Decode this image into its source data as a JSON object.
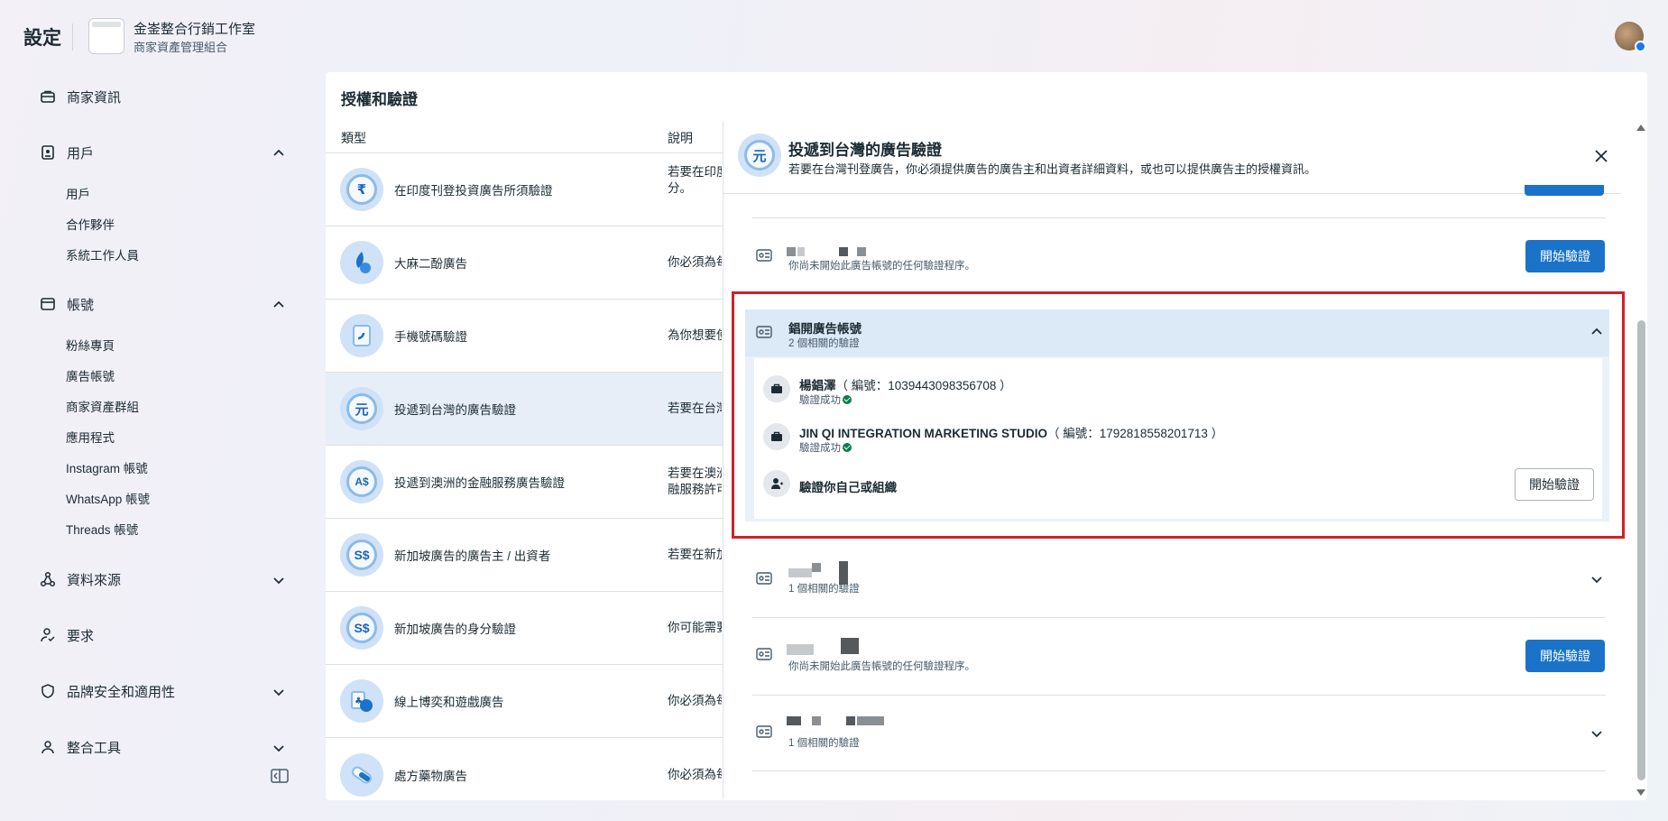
{
  "header": {
    "title": "設定",
    "business_name": "金崟整合行銷工作室",
    "business_sub": "商家資產管理組合"
  },
  "sidebar": {
    "items": [
      {
        "label": "商家資訊",
        "icon": "briefcase-icon"
      },
      {
        "label": "用戶",
        "icon": "user-badge-icon",
        "expanded": true,
        "children": [
          "用戶",
          "合作夥伴",
          "系統工作人員"
        ]
      },
      {
        "label": "帳號",
        "icon": "folder-icon",
        "expanded": true,
        "children": [
          "粉絲專頁",
          "廣告帳號",
          "商家資產群組",
          "應用程式",
          "Instagram 帳號",
          "WhatsApp 帳號",
          "Threads 帳號"
        ]
      },
      {
        "label": "資料來源",
        "icon": "nodes-icon",
        "expanded": false
      },
      {
        "label": "要求",
        "icon": "user-check-icon"
      },
      {
        "label": "品牌安全和適用性",
        "icon": "shield-icon",
        "expanded": false
      },
      {
        "label": "整合工具",
        "icon": "tools-icon",
        "expanded": false
      }
    ]
  },
  "main": {
    "section_title": "授權和驗證",
    "col_type": "類型",
    "col_desc": "說明",
    "rows": [
      {
        "label": "在印度刊登投資廣告所須驗證",
        "desc1": "若要在印度",
        "desc2": "分。",
        "icon": "₹"
      },
      {
        "label": "大麻二酚廣告",
        "desc1": "你必須為每",
        "icon": "cbd"
      },
      {
        "label": "手機號碼驗證",
        "desc1": "為你想要使",
        "icon": "phone"
      },
      {
        "label": "投遞到台灣的廣告驗證",
        "desc1": "若要在台灣",
        "icon": "元",
        "selected": true
      },
      {
        "label": "投遞到澳洲的金融服務廣告驗證",
        "desc1": "若要在澳洲",
        "desc2": "融服務許可",
        "icon": "A$"
      },
      {
        "label": "新加坡廣告的廣告主 / 出資者",
        "desc1": "若要在新加",
        "icon": "S$"
      },
      {
        "label": "新加坡廣告的身分驗證",
        "desc1": "你可能需要",
        "icon": "S$"
      },
      {
        "label": "線上博奕和遊戲廣告",
        "desc1": "你必須為每",
        "icon": "cards"
      },
      {
        "label": "處方藥物廣告",
        "desc1": "你必須為每",
        "icon": "pill"
      }
    ]
  },
  "panel": {
    "icon_text": "元",
    "title": "投遞到台灣的廣告驗證",
    "description": "若要在台灣刊登廣告，你必須提供廣告的廣告主和出資者詳細資料，或也可以提供廣告主的授權資訊。",
    "not_started": "你尚未開始此廣告帳號的任何驗證程序。",
    "start_button": "開始驗證",
    "expanded_account": {
      "name": "錩開廣告帳號",
      "related": "2 個相關的驗證",
      "entities": [
        {
          "name": "楊錩澤",
          "number": "（ 編號：1039443098356708 ）",
          "status": "驗證成功"
        },
        {
          "name": "JIN QI INTEGRATION MARKETING STUDIO",
          "number": "（ 編號：1792818558201713 ）",
          "status": "驗證成功"
        }
      ],
      "verify_self": "驗證你自己或組織",
      "verify_button": "開始驗證"
    },
    "account3_related": "1 個相關的驗證",
    "account5_related": "1 個相關的驗證"
  },
  "colors": {
    "accent": "#1a73c9",
    "highlight": "#d0202a",
    "success": "#0e7a4d"
  }
}
